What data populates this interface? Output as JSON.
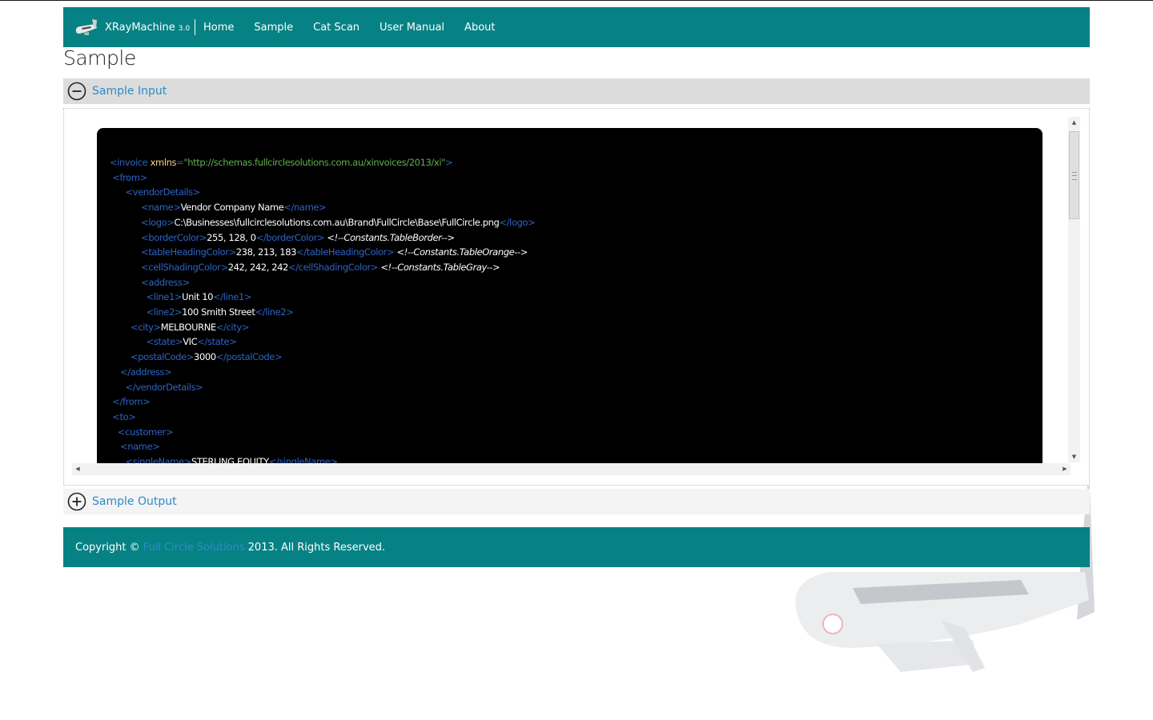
{
  "header": {
    "brand_name": "XRayMachine",
    "brand_version": "3.0",
    "nav": [
      "Home",
      "Sample",
      "Cat Scan",
      "User Manual",
      "About"
    ]
  },
  "page_title": "Sample",
  "sections": {
    "input": {
      "title": "Sample Input",
      "state": "expanded",
      "icon": "minus-circle-icon"
    },
    "output": {
      "title": "Sample Output",
      "state": "collapsed",
      "icon": "plus-circle-icon"
    }
  },
  "code_lines": [
    [
      [
        "",
        "<invoice "
      ],
      [
        "attr",
        "xmlns"
      ],
      [
        "",
        "="
      ],
      [
        "str",
        "\"http://schemas.fullcirclesolutions.com.au/xinvoices/2013/xi\""
      ],
      [
        "tag",
        ">"
      ]
    ],
    [
      [
        "",
        " "
      ],
      [
        "tag",
        "<from>"
      ]
    ],
    [
      [
        "",
        "      "
      ],
      [
        "tag",
        "<vendorDetails>"
      ]
    ],
    [
      [
        "",
        "            "
      ],
      [
        "tag",
        "<name>"
      ],
      [
        "text",
        "Vendor Company Name"
      ],
      [
        "tag",
        "</name>"
      ]
    ],
    [
      [
        "",
        "            "
      ],
      [
        "tag",
        "<logo>"
      ],
      [
        "text",
        "C:\\Businesses\\fullcirclesolutions.com.au\\Brand\\FullCircle\\Base\\FullCircle.png"
      ],
      [
        "tag",
        "</logo>"
      ]
    ],
    [
      [
        "",
        "            "
      ],
      [
        "tag",
        "<borderColor>"
      ],
      [
        "text",
        "255, 128, 0"
      ],
      [
        "tag",
        "</borderColor>"
      ],
      [
        "text",
        " "
      ],
      [
        "cmt",
        "<!--Constants.TableBorder-->"
      ]
    ],
    [
      [
        "",
        "            "
      ],
      [
        "tag",
        "<tableHeadingColor>"
      ],
      [
        "text",
        "238, 213, 183"
      ],
      [
        "tag",
        "</tableHeadingColor>"
      ],
      [
        "text",
        " "
      ],
      [
        "cmt",
        "<!--Constants.TableOrange-->"
      ]
    ],
    [
      [
        "",
        "            "
      ],
      [
        "tag",
        "<cellShadingColor>"
      ],
      [
        "text",
        "242, 242, 242"
      ],
      [
        "tag",
        "</cellShadingColor>"
      ],
      [
        "text",
        " "
      ],
      [
        "cmt",
        "<!--Constants.TableGray-->"
      ]
    ],
    [
      [
        "",
        "            "
      ],
      [
        "tag",
        "<address>"
      ]
    ],
    [
      [
        "",
        "              "
      ],
      [
        "tag",
        "<line1>"
      ],
      [
        "text",
        "Unit 10"
      ],
      [
        "tag",
        "</line1>"
      ]
    ],
    [
      [
        "",
        "              "
      ],
      [
        "tag",
        "<line2>"
      ],
      [
        "text",
        "100 Smith Street"
      ],
      [
        "tag",
        "</line2>"
      ]
    ],
    [
      [
        "",
        "        "
      ],
      [
        "tag",
        "<city>"
      ],
      [
        "text",
        "MELBOURNE"
      ],
      [
        "tag",
        "</city>"
      ]
    ],
    [
      [
        "",
        "              "
      ],
      [
        "tag",
        "<state>"
      ],
      [
        "text",
        "VIC"
      ],
      [
        "tag",
        "</state>"
      ]
    ],
    [
      [
        "",
        "        "
      ],
      [
        "tag",
        "<postalCode>"
      ],
      [
        "text",
        "3000"
      ],
      [
        "tag",
        "</postalCode>"
      ]
    ],
    [
      [
        "",
        "    "
      ],
      [
        "tag",
        "</address>"
      ]
    ],
    [
      [
        "",
        "      "
      ],
      [
        "tag",
        "</vendorDetails>"
      ]
    ],
    [
      [
        "",
        " "
      ],
      [
        "tag",
        "</from>"
      ]
    ],
    [
      [
        "",
        " "
      ],
      [
        "tag",
        "<to>"
      ]
    ],
    [
      [
        "",
        "   "
      ],
      [
        "tag",
        "<customer>"
      ]
    ],
    [
      [
        "",
        "    "
      ],
      [
        "tag",
        "<name>"
      ]
    ],
    [
      [
        "",
        "      "
      ],
      [
        "tag",
        "<singleName>"
      ],
      [
        "text",
        "STERLING EQUITY"
      ],
      [
        "tag",
        "</singleName>"
      ]
    ]
  ],
  "footer": {
    "prefix": "Copyright © ",
    "link": "Full Circle Solutions",
    "suffix": " 2013. All Rights Reserved."
  },
  "colors": {
    "header_bg": "#068284",
    "link": "#2e8bc9",
    "xml_tag": "#2e63c4",
    "xml_attr": "#ffd28a",
    "xml_string": "#5fb24a"
  }
}
